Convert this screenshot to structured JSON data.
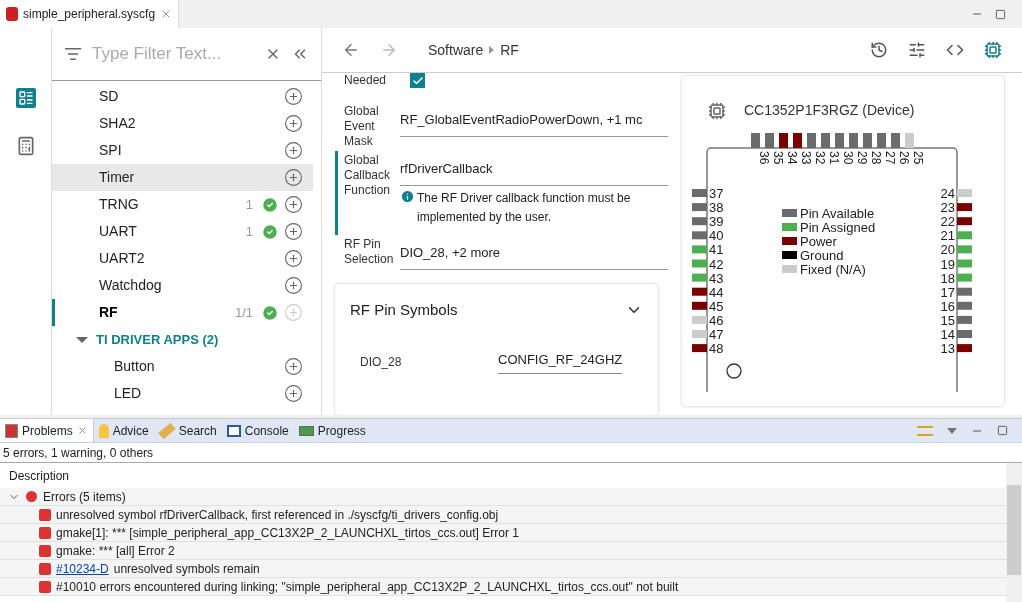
{
  "editor_tab": {
    "title": "simple_peripheral.syscfg"
  },
  "sidebar": {
    "filter_placeholder": "Type Filter Text...",
    "items": [
      {
        "kind": "module",
        "label": "SD",
        "selected": false,
        "hovered": false,
        "add_disabled": false
      },
      {
        "kind": "module",
        "label": "SHA2",
        "selected": false,
        "hovered": false,
        "add_disabled": false
      },
      {
        "kind": "module",
        "label": "SPI",
        "selected": false,
        "hovered": false,
        "add_disabled": false
      },
      {
        "kind": "module",
        "label": "Timer",
        "selected": false,
        "hovered": true,
        "add_disabled": false
      },
      {
        "kind": "module",
        "label": "TRNG",
        "count": "1",
        "ok": true,
        "selected": false,
        "hovered": false,
        "add_disabled": false
      },
      {
        "kind": "module",
        "label": "UART",
        "count": "1",
        "ok": true,
        "selected": false,
        "hovered": false,
        "add_disabled": false
      },
      {
        "kind": "module",
        "label": "UART2",
        "selected": false,
        "hovered": false,
        "add_disabled": false
      },
      {
        "kind": "module",
        "label": "Watchdog",
        "selected": false,
        "hovered": false,
        "add_disabled": false
      },
      {
        "kind": "module",
        "label": "RF",
        "count": "1/1",
        "ok": true,
        "selected": true,
        "hovered": false,
        "add_disabled": true
      },
      {
        "kind": "group",
        "label": "TI DRIVER APPS (2)",
        "expanded": true,
        "children": [
          {
            "kind": "module",
            "label": "Button",
            "selected": false,
            "hovered": false,
            "add_disabled": false
          },
          {
            "kind": "module",
            "label": "LED",
            "selected": false,
            "hovered": false,
            "add_disabled": false
          }
        ]
      }
    ]
  },
  "breadcrumb": [
    "Software",
    "RF"
  ],
  "form": {
    "fields": [
      {
        "kind": "checkbox",
        "label": "Needed",
        "checked": true,
        "selected": false
      },
      {
        "kind": "text",
        "label": "Global Event Mask",
        "value": "RF_GlobalEventRadioPowerDown, +1 mc",
        "selected": false
      },
      {
        "kind": "text",
        "label": "Global Callback Function",
        "value": "rfDriverCallback",
        "info": "The RF Driver callback function must be implemented by the user.",
        "selected": true
      },
      {
        "kind": "text",
        "label": "RF Pin Selection",
        "value": "DIO_28, +2 more",
        "selected": false
      }
    ],
    "pin_symbols": {
      "title": "RF Pin Symbols",
      "expanded": true,
      "rows": [
        {
          "pin": "DIO_28",
          "symbol": "CONFIG_RF_24GHZ"
        }
      ]
    }
  },
  "device": {
    "title": "CC1352P1F3RGZ (Device)",
    "legend": [
      {
        "label": "Pin Available",
        "kind": "available"
      },
      {
        "label": "Pin Assigned",
        "kind": "assigned"
      },
      {
        "label": "Power",
        "kind": "power"
      },
      {
        "label": "Ground",
        "kind": "ground"
      },
      {
        "label": "Fixed (N/A)",
        "kind": "fixed"
      }
    ],
    "pins": {
      "top": [
        {
          "number": "36",
          "kind": "available"
        },
        {
          "number": "35",
          "kind": "available"
        },
        {
          "number": "34",
          "kind": "power"
        },
        {
          "number": "33",
          "kind": "power"
        },
        {
          "number": "32",
          "kind": "available"
        },
        {
          "number": "31",
          "kind": "available"
        },
        {
          "number": "30",
          "kind": "available"
        },
        {
          "number": "29",
          "kind": "available"
        },
        {
          "number": "28",
          "kind": "available"
        },
        {
          "number": "27",
          "kind": "available"
        },
        {
          "number": "26",
          "kind": "available"
        },
        {
          "number": "25",
          "kind": "fixed"
        }
      ],
      "left": [
        {
          "number": "37",
          "kind": "available"
        },
        {
          "number": "38",
          "kind": "available"
        },
        {
          "number": "39",
          "kind": "available"
        },
        {
          "number": "40",
          "kind": "available"
        },
        {
          "number": "41",
          "kind": "assigned"
        },
        {
          "number": "42",
          "kind": "assigned"
        },
        {
          "number": "43",
          "kind": "assigned"
        },
        {
          "number": "44",
          "kind": "power"
        },
        {
          "number": "45",
          "kind": "power"
        },
        {
          "number": "46",
          "kind": "fixed"
        },
        {
          "number": "47",
          "kind": "fixed"
        },
        {
          "number": "48",
          "kind": "power"
        }
      ],
      "right": [
        {
          "number": "24",
          "kind": "fixed"
        },
        {
          "number": "23",
          "kind": "power"
        },
        {
          "number": "22",
          "kind": "power"
        },
        {
          "number": "21",
          "kind": "assigned"
        },
        {
          "number": "20",
          "kind": "assigned"
        },
        {
          "number": "19",
          "kind": "assigned"
        },
        {
          "number": "18",
          "kind": "assigned"
        },
        {
          "number": "17",
          "kind": "available"
        },
        {
          "number": "16",
          "kind": "available"
        },
        {
          "number": "15",
          "kind": "available"
        },
        {
          "number": "14",
          "kind": "available"
        },
        {
          "number": "13",
          "kind": "power"
        }
      ]
    }
  },
  "problems": {
    "tabs": [
      {
        "label": "Problems",
        "kind": "problems",
        "selected": true
      },
      {
        "label": "Advice",
        "kind": "advice",
        "selected": false
      },
      {
        "label": "Search",
        "kind": "search",
        "selected": false
      },
      {
        "label": "Console",
        "kind": "console",
        "selected": false
      },
      {
        "label": "Progress",
        "kind": "progress",
        "selected": false
      }
    ],
    "summary": "5 errors, 1 warning, 0 others",
    "column": "Description",
    "groups": [
      {
        "label": "Errors (5 items)",
        "expanded": true,
        "items": [
          {
            "text": "unresolved symbol rfDriverCallback, first referenced in ./syscfg/ti_drivers_config.obj"
          },
          {
            "text": "gmake[1]: *** [simple_peripheral_app_CC13X2P_2_LAUNCHXL_tirtos_ccs.out] Error 1"
          },
          {
            "text": "gmake: *** [all] Error 2"
          },
          {
            "link": "#10234-D",
            "text": "unresolved symbols remain"
          },
          {
            "text": "#10010 errors encountered during linking; \"simple_peripheral_app_CC13X2P_2_LAUNCHXL_tirtos_ccs.out\" not built"
          }
        ]
      }
    ]
  }
}
